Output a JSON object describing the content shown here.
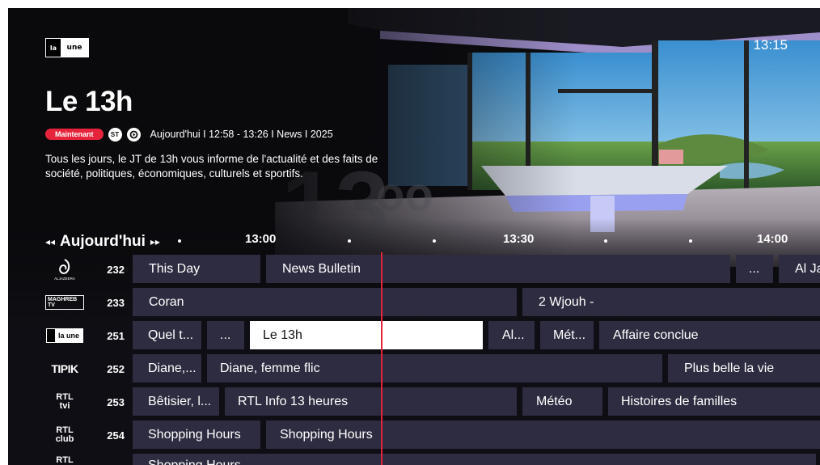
{
  "header": {
    "channel_logo": {
      "left": "la",
      "right": "une"
    },
    "clock": "13:15"
  },
  "program": {
    "title": "Le 13h",
    "badge": "Maintenant",
    "icons": [
      "st-subtitles-icon",
      "audio-description-icon"
    ],
    "st_label": "ST",
    "meta": "Aujourd'hui I 12:58 - 13:26 I News I 2025",
    "description": "Tous les jours, le JT de 13h vous informe de l'actualité et des faits de société, politiques, économiques, culturels et sportifs."
  },
  "timeline": {
    "prev_arrow": "◂◂",
    "day": "Aujourd'hui",
    "next_arrow": "▸▸",
    "ticks": [
      "13:00",
      "13:30",
      "14:00"
    ]
  },
  "channels": [
    {
      "number": "232",
      "logo": "al-jazeera-logo-icon",
      "logo_text": "ALJAZEERA",
      "programs": [
        "This Day",
        "News Bulletin",
        "...",
        "Al Ja"
      ]
    },
    {
      "number": "233",
      "logo": "maghreb-tv-logo-icon",
      "logo_text": "MAGHREB TV",
      "programs": [
        "Coran",
        "2 Wjouh -"
      ]
    },
    {
      "number": "251",
      "logo": "la-une-logo-icon",
      "logo_text": "la une",
      "programs": [
        "Quel t...",
        "...",
        "Le 13h",
        "Al...",
        "Mét...",
        "Affaire conclue"
      ]
    },
    {
      "number": "252",
      "logo": "tipik-logo-icon",
      "logo_text": "TIPIK",
      "programs": [
        "Diane,...",
        "Diane, femme flic",
        "Plus belle la vie"
      ]
    },
    {
      "number": "253",
      "logo": "rtl-tvi-logo-icon",
      "logo_text": "RTL tvi",
      "programs": [
        "Bêtisier, l...",
        "RTL Info 13 heures",
        "Météo",
        "Histoires de familles"
      ]
    },
    {
      "number": "254",
      "logo": "rtl-club-logo-icon",
      "logo_text": "RTL club",
      "programs": [
        "Shopping Hours",
        "Shopping Hours"
      ]
    },
    {
      "number": "",
      "logo": "rtl-plug-logo-icon",
      "logo_text": "RTL",
      "programs": [
        "Shopping Hours"
      ]
    }
  ],
  "colors": {
    "accent": "#e5243b",
    "cell": "#2e2c40",
    "selected": "#ffffff",
    "background": "#0e0e14"
  }
}
